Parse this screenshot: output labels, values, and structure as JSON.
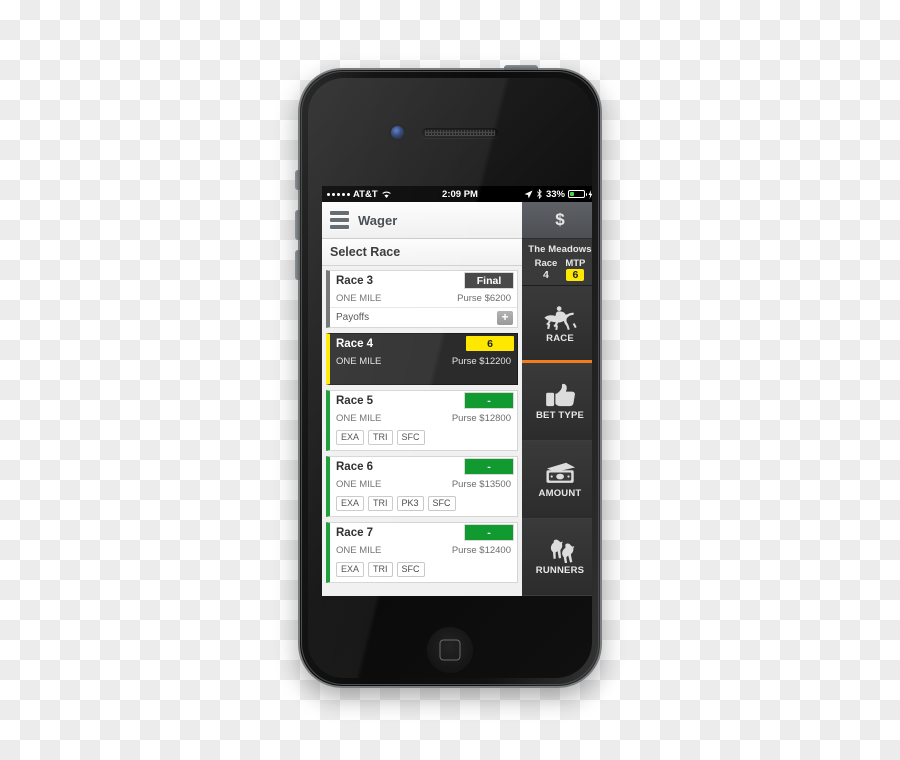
{
  "status_bar": {
    "carrier": "AT&T",
    "signal_dots": 5,
    "wifi_icon": "wifi-icon",
    "time": "2:09 PM",
    "location_icon": "location-arrow-icon",
    "bluetooth_icon": "bluetooth-icon",
    "battery_percent": "33%",
    "battery_level": 33,
    "charging_icon": "lightning-bolt-icon"
  },
  "app_bar": {
    "menu_icon": "hamburger-menu-icon",
    "title": "Wager",
    "dollar_label": "$"
  },
  "main": {
    "section_title": "Select Race",
    "races": [
      {
        "name": "Race 3",
        "badge": "Final",
        "badge_type": "gray",
        "distance": "ONE MILE",
        "purse": "Purse $6200",
        "state": "final",
        "chips": [],
        "payoffs_label": "Payoffs",
        "payoffs_expand": "+"
      },
      {
        "name": "Race 4",
        "badge": "6",
        "badge_type": "yellow",
        "distance": "ONE MILE",
        "purse": "Purse $12200",
        "state": "selected",
        "chips": []
      },
      {
        "name": "Race 5",
        "badge": "-",
        "badge_type": "green",
        "distance": "ONE MILE",
        "purse": "Purse $12800",
        "state": "open",
        "chips": [
          "EXA",
          "TRI",
          "SFC"
        ]
      },
      {
        "name": "Race 6",
        "badge": "-",
        "badge_type": "green",
        "distance": "ONE MILE",
        "purse": "Purse $13500",
        "state": "open",
        "chips": [
          "EXA",
          "TRI",
          "PK3",
          "SFC"
        ]
      },
      {
        "name": "Race 7",
        "badge": "-",
        "badge_type": "green",
        "distance": "ONE MILE",
        "purse": "Purse $12400",
        "state": "open",
        "chips": [
          "EXA",
          "TRI",
          "SFC"
        ]
      }
    ]
  },
  "sidebar": {
    "track_name": "The Meadows",
    "race_label": "Race",
    "race_value": "4",
    "mtp_label": "MTP",
    "mtp_value": "6",
    "items": [
      {
        "label": "RACE",
        "icon": "horse-jockey-icon",
        "active": true
      },
      {
        "label": "BET TYPE",
        "icon": "thumbs-up-icon",
        "active": false
      },
      {
        "label": "AMOUNT",
        "icon": "cash-money-icon",
        "active": false
      },
      {
        "label": "RUNNERS",
        "icon": "two-horses-icon",
        "active": false
      }
    ]
  },
  "device": {
    "front_camera_icon": "front-camera-icon",
    "earpiece_icon": "earpiece-speaker-icon",
    "home_button_icon": "home-button-icon"
  },
  "colors": {
    "accent_orange": "#f07d20",
    "mtp_yellow": "#ffe800",
    "open_green": "#109a30",
    "final_gray": "#4a4a4a",
    "sidebar_dark": "#2f2f2f"
  }
}
